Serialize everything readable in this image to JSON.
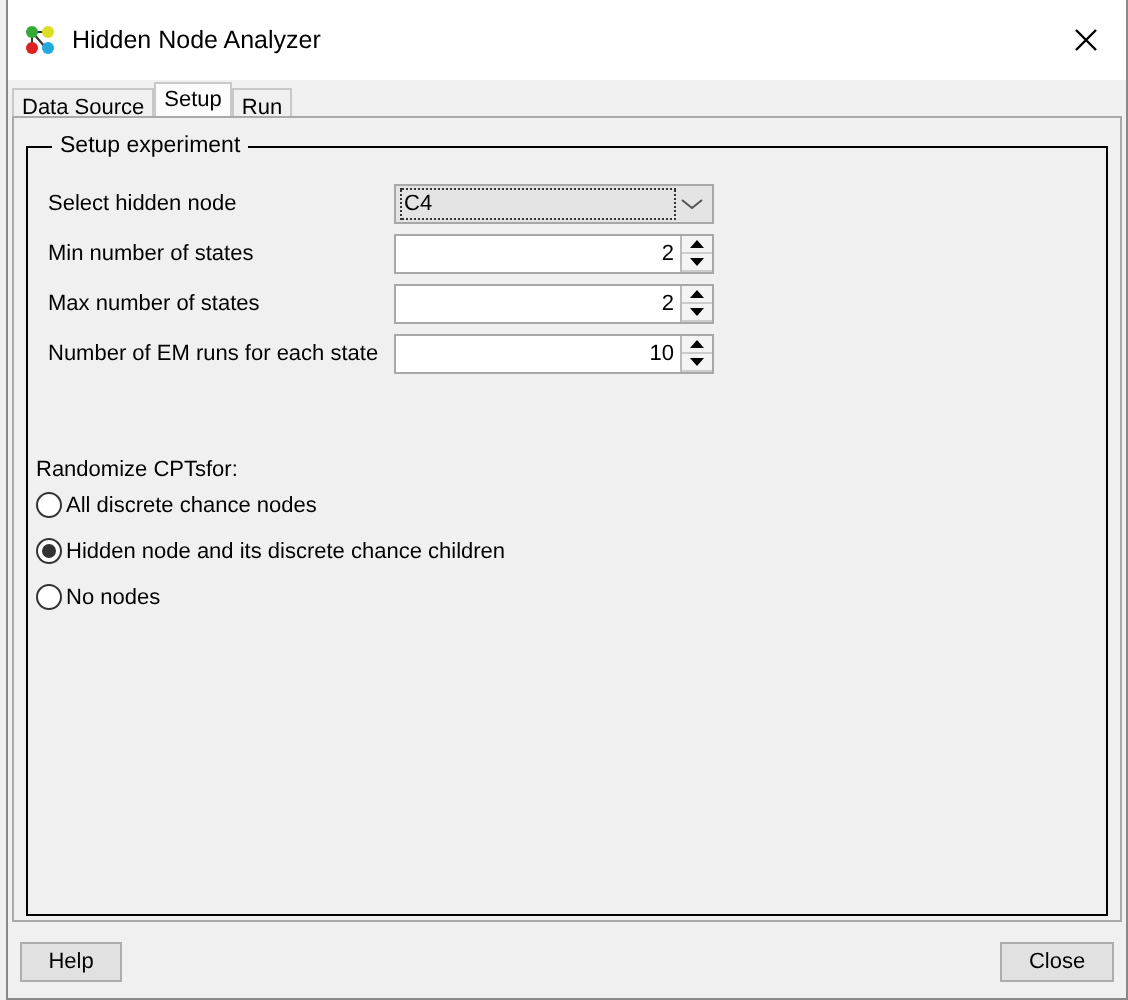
{
  "window": {
    "title": "Hidden Node Analyzer"
  },
  "tabs": [
    {
      "label": "Data Source",
      "selected": false
    },
    {
      "label": "Setup",
      "selected": true
    },
    {
      "label": "Run",
      "selected": false
    }
  ],
  "group": {
    "legend": "Setup experiment",
    "fields": [
      {
        "kind": "dropdown",
        "label": "Select hidden node",
        "value": "C4"
      },
      {
        "kind": "spinner",
        "label": "Min number of states",
        "value": "2"
      },
      {
        "kind": "spinner",
        "label": "Max number of states",
        "value": "2"
      },
      {
        "kind": "spinner",
        "label": "Number of EM runs for each state",
        "value": "10"
      }
    ],
    "randomize_label": "Randomize CPTsfor:",
    "options": [
      {
        "label": "All discrete chance nodes",
        "selected": false
      },
      {
        "label": "Hidden node and its discrete chance children",
        "selected": true
      },
      {
        "label": "No nodes",
        "selected": false
      }
    ]
  },
  "buttons": [
    {
      "label": "Help"
    },
    {
      "label": "Close"
    }
  ]
}
